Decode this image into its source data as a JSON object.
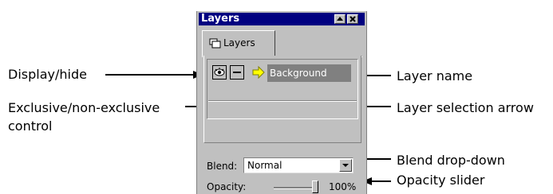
{
  "callouts": {
    "display_hide": "Display/hide",
    "exclusive_line1": "Exclusive/non-exclusive",
    "exclusive_line2": "control",
    "layer_name": "Layer name",
    "layer_selection_arrow": "Layer selection arrow",
    "blend_dropdown": "Blend drop-down",
    "opacity_slider": "Opacity slider"
  },
  "palette": {
    "title": "Layers",
    "titlebar_buttons": [
      "minimize-icon",
      "close-icon"
    ],
    "tab_label": "Layers",
    "tab_icon": "layers-icon",
    "layers": [
      {
        "name": "Background",
        "visible": true,
        "exclusive": false,
        "selected": true
      }
    ],
    "blend": {
      "label": "Blend:",
      "value": "Normal"
    },
    "opacity": {
      "label": "Opacity:",
      "value_text": "100%",
      "percent": 100
    }
  },
  "colors": {
    "titlebar": "#000080",
    "panel": "#c0c0c0",
    "selected_layer_bg": "#808080",
    "selection_arrow": "#ffff00"
  }
}
